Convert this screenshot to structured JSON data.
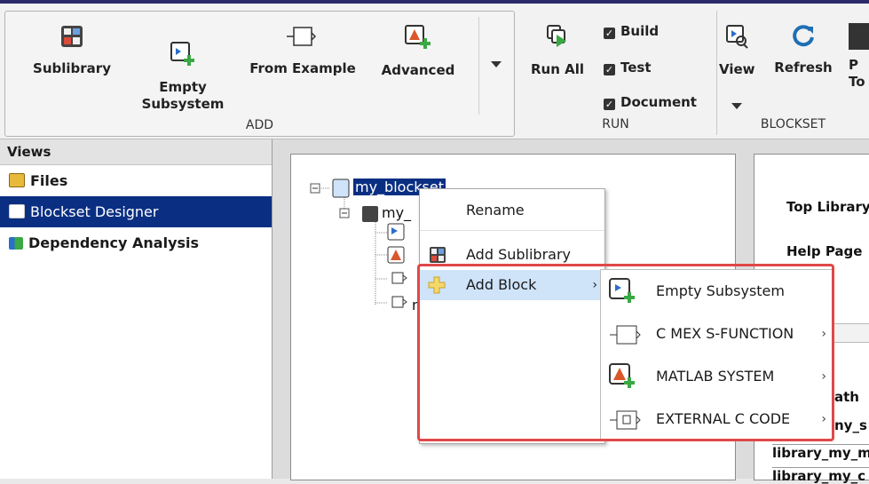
{
  "toolstrip": {
    "add": {
      "title": "ADD",
      "buttons": [
        {
          "label": "Sublibrary",
          "icon": "sublibrary-icon"
        },
        {
          "label": "Empty\nSubsystem",
          "icon": "empty-subsystem-icon"
        },
        {
          "label": "From Example",
          "icon": "from-example-icon"
        },
        {
          "label": "Advanced",
          "icon": "advanced-icon"
        }
      ]
    },
    "run": {
      "title": "RUN",
      "run_all": "Run All",
      "checks": [
        {
          "label": "Build",
          "checked": true
        },
        {
          "label": "Test",
          "checked": true
        },
        {
          "label": "Document",
          "checked": true
        }
      ]
    },
    "blockset": {
      "title": "BLOCKSET",
      "view": "View",
      "refresh": "Refresh",
      "publish_partial": "P",
      "publish_partial2": "To"
    }
  },
  "views": {
    "header": "Views",
    "items": [
      {
        "label": "Files",
        "selected": false
      },
      {
        "label": "Blockset Designer",
        "selected": true
      },
      {
        "label": "Dependency Analysis",
        "selected": false
      }
    ]
  },
  "tree": {
    "root": "my_blockset",
    "child": "my_",
    "hidden_item": "my_sfunbuilder"
  },
  "context_menu": {
    "items": [
      {
        "label": "Rename"
      },
      {
        "label": "Add Sublibrary"
      },
      {
        "label": "Add Block",
        "highlighted": true
      }
    ]
  },
  "submenu": {
    "items": [
      {
        "label": "Empty Subsystem",
        "has_submenu": false
      },
      {
        "label": "C MEX S-FUNCTION",
        "has_submenu": true
      },
      {
        "label": "MATLAB SYSTEM",
        "has_submenu": true
      },
      {
        "label": "EXTERNAL C CODE",
        "has_submenu": true
      }
    ]
  },
  "right_panel": {
    "top_library": "Top Library",
    "help_page": "Help Page",
    "path": "ath",
    "row1": "ny_s",
    "row2": "library_my_m",
    "row3": "library_my_c"
  },
  "colors": {
    "selection": "#0a2f82",
    "highlight_box": "#e04848",
    "menu_hover": "#cfe3f9"
  }
}
